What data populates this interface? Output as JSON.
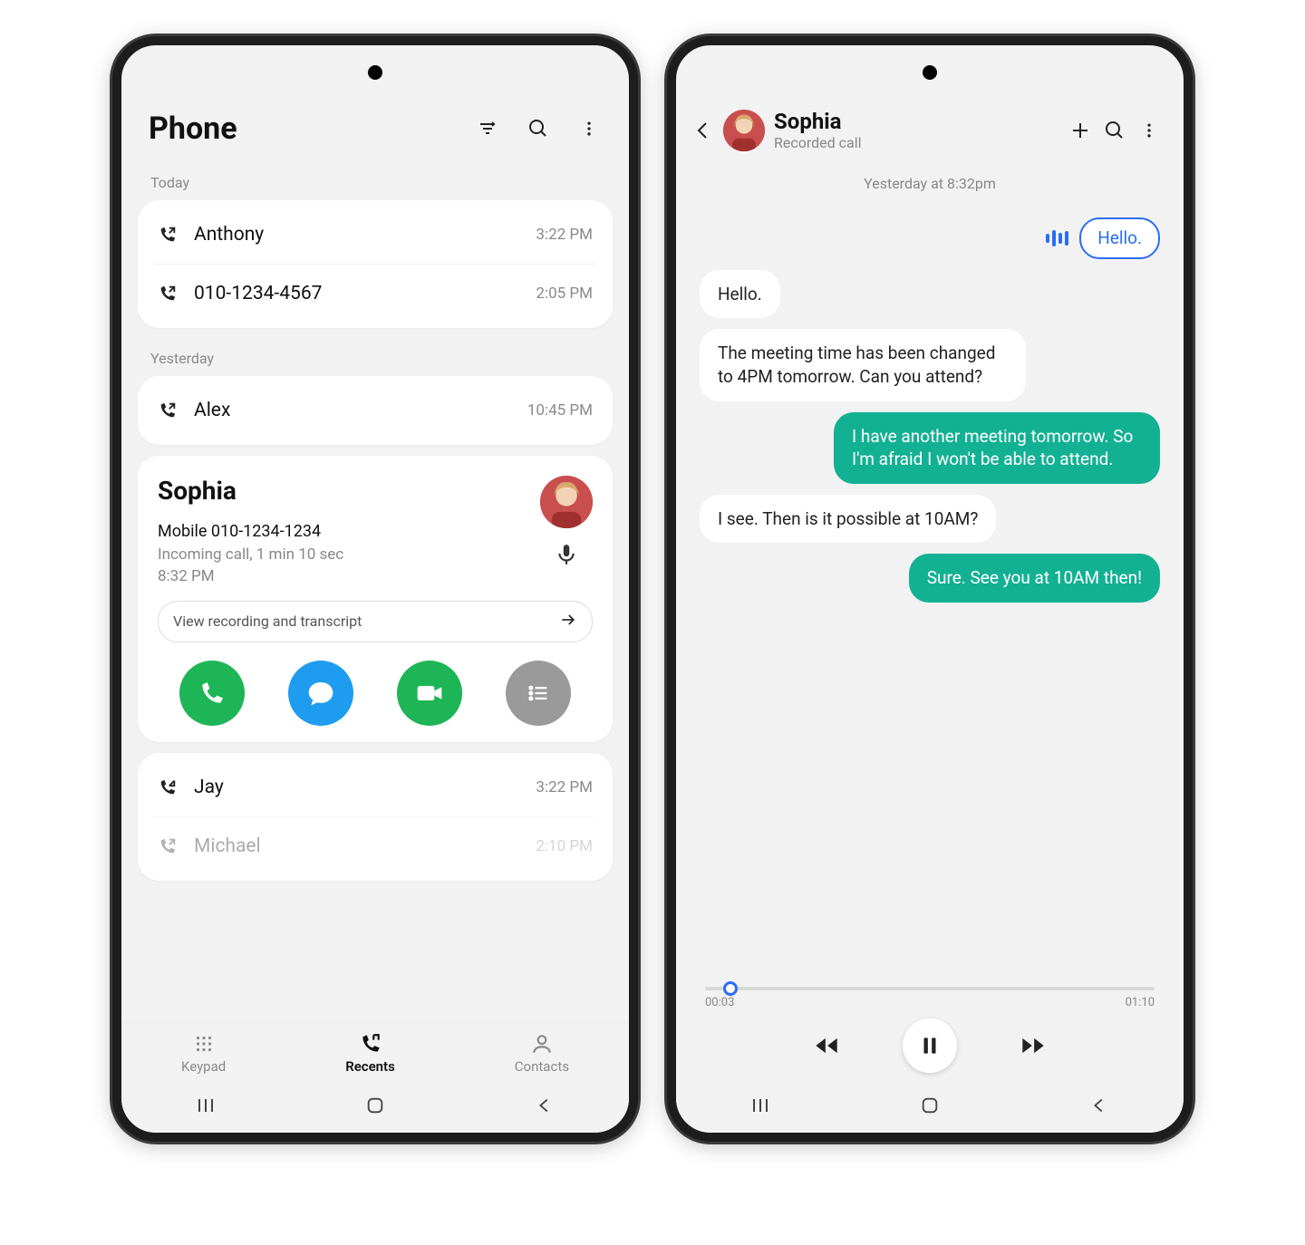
{
  "left": {
    "title": "Phone",
    "sections": {
      "today_label": "Today",
      "yesterday_label": "Yesterday"
    },
    "today": [
      {
        "name": "Anthony",
        "time": "3:22 PM",
        "dir": "out"
      },
      {
        "name": "010-1234-4567",
        "time": "2:05 PM",
        "dir": "out"
      }
    ],
    "yesterday": [
      {
        "name": "Alex",
        "time": "10:45 PM",
        "dir": "out"
      }
    ],
    "expanded": {
      "name": "Sophia",
      "number_line": "Mobile 010-1234-1234",
      "desc_line": "Incoming call, 1 min 10 sec",
      "time": "8:32 PM",
      "transcript_label": "View recording and transcript"
    },
    "after": [
      {
        "name": "Jay",
        "time": "3:22 PM",
        "dir": "in"
      },
      {
        "name": "Michael",
        "time": "2:10 PM",
        "dir": "out"
      }
    ],
    "tabs": {
      "keypad": "Keypad",
      "recents": "Recents",
      "contacts": "Contacts"
    }
  },
  "right": {
    "name": "Sophia",
    "subtitle": "Recorded call",
    "timestamp": "Yesterday at 8:32pm",
    "echo": "Hello.",
    "messages": [
      {
        "side": "in",
        "text": "Hello."
      },
      {
        "side": "in",
        "text": "The meeting time has been changed to 4PM tomorrow. Can you attend?"
      },
      {
        "side": "out",
        "text": "I have another meeting tomorrow. So I'm afraid I won't be able to attend."
      },
      {
        "side": "in",
        "text": "I see. Then is it possible at 10AM?"
      },
      {
        "side": "out",
        "text": "Sure. See you at 10AM then!"
      }
    ],
    "player": {
      "elapsed": "00:03",
      "total": "01:10"
    }
  }
}
